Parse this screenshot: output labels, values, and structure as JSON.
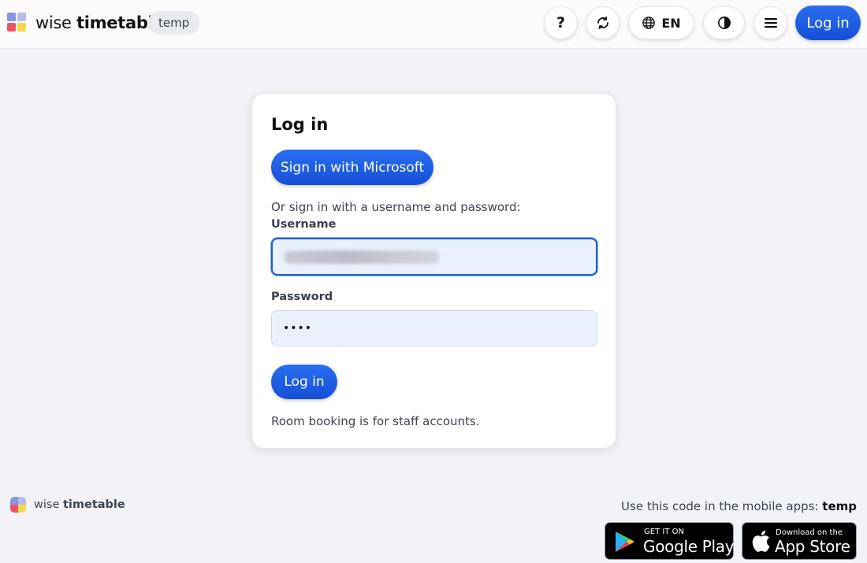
{
  "header": {
    "brand_light": "wise",
    "brand_bold": "timetable",
    "school_code": "temp",
    "help_label": "?",
    "language": "EN",
    "login_label": "Log in"
  },
  "login_card": {
    "title": "Log in",
    "microsoft_button": "Sign in with Microsoft",
    "alt_text": "Or sign in with a username and password:",
    "username_label": "Username",
    "password_label": "Password",
    "password_value": "••••",
    "submit_button": "Log in",
    "note": "Room booking is for staff accounts."
  },
  "footer": {
    "brand_light": "wise",
    "brand_bold": "timetable",
    "mobile_code_text": "Use this code in the mobile apps:",
    "mobile_code": "temp",
    "google_play_small": "GET IT ON",
    "google_play_big": "Google Play",
    "app_store_small": "Download on the",
    "app_store_big": "App Store"
  },
  "colors": {
    "accent": "#1d5bd6",
    "background": "#f1f3f8"
  },
  "icons": [
    "sync-icon",
    "globe-icon",
    "contrast-icon",
    "menu-icon",
    "google-play-icon",
    "apple-icon"
  ]
}
